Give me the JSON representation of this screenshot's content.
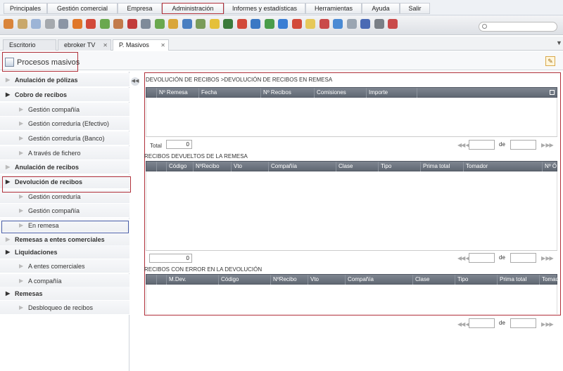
{
  "menu": {
    "items": [
      "Principales",
      "Gestión comercial",
      "Empresa",
      "Administración",
      "Informes y estadísticas",
      "Herramientas",
      "Ayuda",
      "Salir"
    ]
  },
  "toolbar": {
    "icon_colors": [
      "#d9843a",
      "#c9a86b",
      "#9cb4d6",
      "#a5a9ae",
      "#8b95a5",
      "#e0772a",
      "#d24a3a",
      "#6aa84f",
      "#c27a4b",
      "#c23b3b",
      "#7e8a99",
      "#6aa84f",
      "#d9a63a",
      "#4a7fc1",
      "#7a9c5a",
      "#e5c03a",
      "#3b7a3b",
      "#d24a3a",
      "#3a78c4",
      "#4a9c4a",
      "#3a7ed4",
      "#d24a3a",
      "#e6c85a",
      "#c94a4a",
      "#4a8ad4",
      "#9aa5b2",
      "#4a6ab4",
      "#7a7f86",
      "#c94a4a"
    ]
  },
  "tabs": [
    {
      "label": "Escritorio",
      "closable": false
    },
    {
      "label": "ebroker TV",
      "closable": true
    },
    {
      "label": "P. Masivos",
      "closable": true
    }
  ],
  "page": {
    "title": "Procesos masivos"
  },
  "sidebar": {
    "items": [
      {
        "label": "Anulación de pólizas",
        "level": "top",
        "expanded": false
      },
      {
        "label": "Cobro de recibos",
        "level": "top",
        "expanded": true
      },
      {
        "label": "Gestión compañía",
        "level": "sub"
      },
      {
        "label": "Gestión correduría (Efectivo)",
        "level": "sub"
      },
      {
        "label": "Gestión correduría (Banco)",
        "level": "sub"
      },
      {
        "label": "A través de fichero",
        "level": "sub"
      },
      {
        "label": "Anulación de recibos",
        "level": "top",
        "expanded": false
      },
      {
        "label": "Devolución de recibos",
        "level": "top",
        "expanded": true
      },
      {
        "label": "Gestión correduría",
        "level": "sub"
      },
      {
        "label": "Gestión compañía",
        "level": "sub"
      },
      {
        "label": "En remesa",
        "level": "sub"
      },
      {
        "label": "Remesas a entes comerciales",
        "level": "top",
        "expanded": false
      },
      {
        "label": "Liquidaciones",
        "level": "top",
        "expanded": true
      },
      {
        "label": "A entes comerciales",
        "level": "sub"
      },
      {
        "label": "A compañía",
        "level": "sub"
      },
      {
        "label": "Remesas",
        "level": "top",
        "expanded": true
      },
      {
        "label": "Desbloqueo de recibos",
        "level": "sub"
      }
    ]
  },
  "section1": {
    "title": "DEVOLUCIÓN DE RECIBOS >DEVOLUCIÓN DE RECIBOS EN REMESA",
    "columns": [
      "Nº Remesa",
      "Fecha",
      "Nº Recibos",
      "Comisiones",
      "Importe"
    ],
    "total_label": "Total",
    "total_value": "0",
    "pager_of": "de"
  },
  "section2": {
    "title": "RECIBOS DEVUELTOS DE LA REMESA",
    "columns": [
      "Código",
      "NºRecibo",
      "Vto",
      "Compañía",
      "Clase",
      "Tipo",
      "Prima total",
      "Tomador",
      "Nº Ó"
    ],
    "total_value": "0",
    "pager_of": "de"
  },
  "section3": {
    "title": "RECIBOS CON ERROR EN LA DEVOLUCIÓN",
    "columns": [
      "M.Dev.",
      "Código",
      "NºRecibo",
      "Vto",
      "Compañía",
      "Clase",
      "Tipo",
      "Prima total",
      "Tomador"
    ],
    "pager_of": "de"
  }
}
